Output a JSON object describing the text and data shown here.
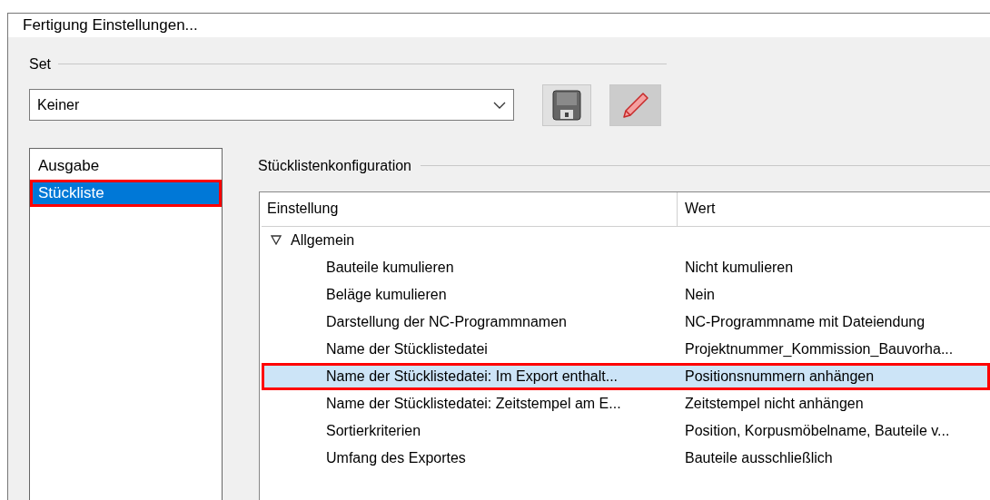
{
  "window": {
    "title": "Fertigung Einstellungen..."
  },
  "set": {
    "label": "Set",
    "value": "Keiner"
  },
  "sidebar": {
    "items": [
      {
        "label": "Ausgabe",
        "selected": false,
        "highlighted": false
      },
      {
        "label": "Stückliste",
        "selected": true,
        "highlighted": true
      }
    ]
  },
  "config": {
    "label": "Stücklistenkonfiguration",
    "columns": [
      "Einstellung",
      "Wert"
    ],
    "group": {
      "label": "Allgemein",
      "expanded": true,
      "rows": [
        {
          "setting": "Bauteile kumulieren",
          "value": "Nicht kumulieren",
          "selected": false,
          "highlighted": false
        },
        {
          "setting": "Beläge kumulieren",
          "value": "Nein",
          "selected": false,
          "highlighted": false
        },
        {
          "setting": "Darstellung der NC-Programmnamen",
          "value": "NC-Programmname mit Dateiendung",
          "selected": false,
          "highlighted": false
        },
        {
          "setting": "Name der Stücklistedatei",
          "value": "Projektnummer_Kommission_Bauvorha...",
          "selected": false,
          "highlighted": false
        },
        {
          "setting": "Name der Stücklistedatei: Im Export enthalt...",
          "value": "Positionsnummern anhängen",
          "selected": true,
          "highlighted": true
        },
        {
          "setting": "Name der Stücklistedatei: Zeitstempel am E...",
          "value": "Zeitstempel nicht anhängen",
          "selected": false,
          "highlighted": false
        },
        {
          "setting": "Sortierkriterien",
          "value": "Position, Korpusmöbelname, Bauteile v...",
          "selected": false,
          "highlighted": false
        },
        {
          "setting": "Umfang des Exportes",
          "value": "Bauteile ausschließlich",
          "selected": false,
          "highlighted": false
        }
      ]
    }
  }
}
